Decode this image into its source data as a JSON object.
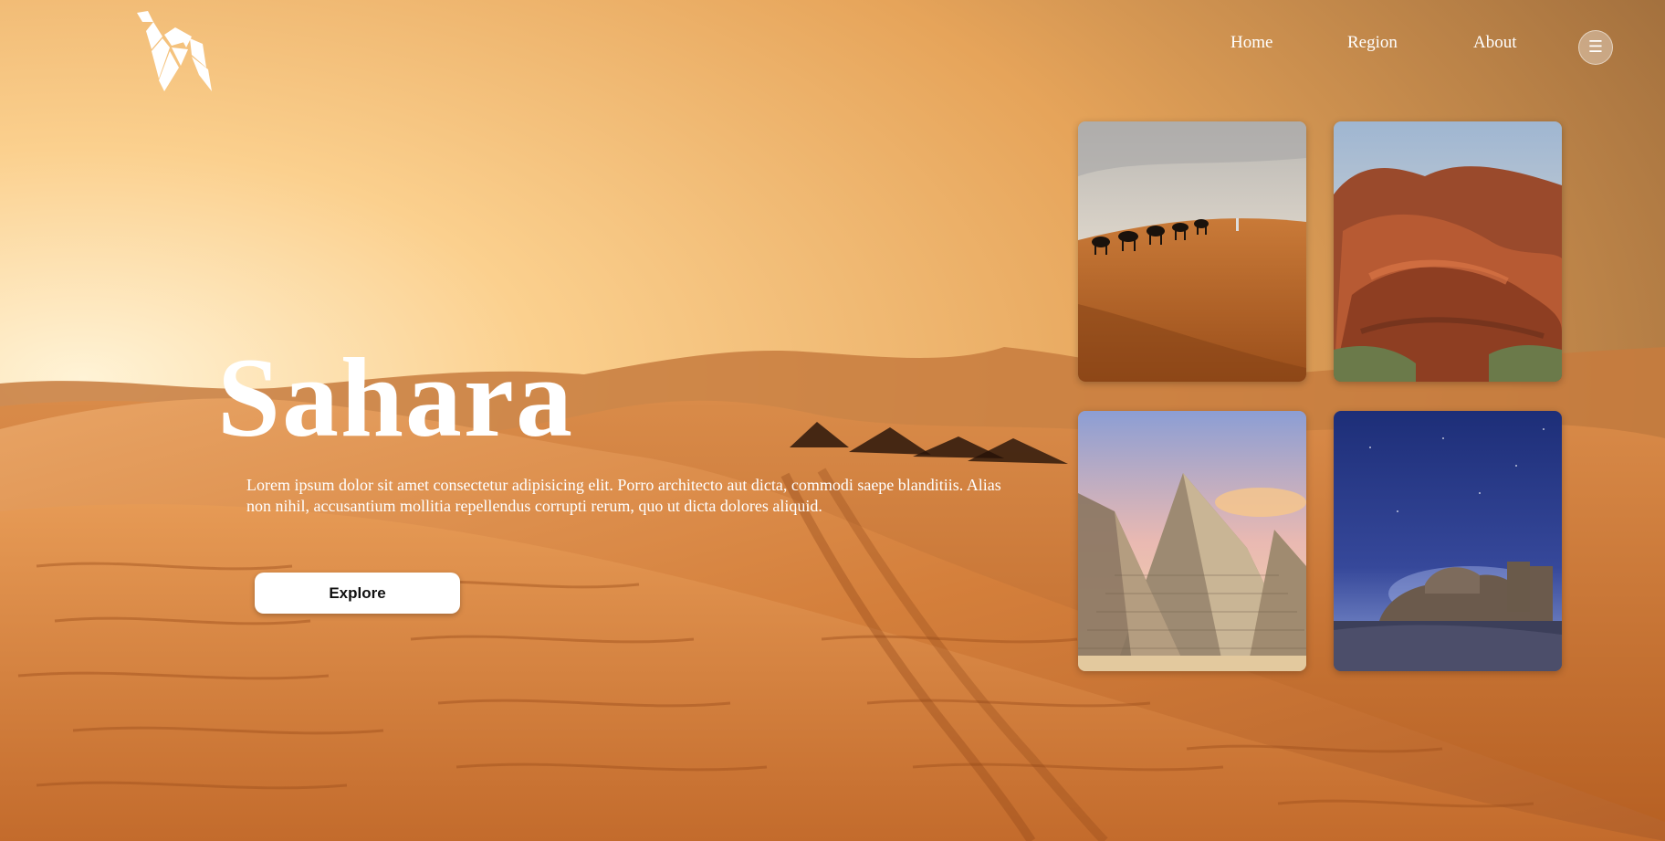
{
  "nav": {
    "home": "Home",
    "region": "Region",
    "about": "About",
    "menu_icon": "hamburger-icon"
  },
  "hero": {
    "title": "Sahara",
    "description": "Lorem ipsum dolor sit amet consectetur adipisicing elit. Porro architecto aut dicta, commodi saepe blanditiis. Alias non nihil, accusantium mollitia repellendus corrupti rerum, quo ut dicta dolores aliquid.",
    "cta": "Explore"
  },
  "gallery": [
    {
      "subject": "camel caravan on dunes"
    },
    {
      "subject": "red sandstone rocks"
    },
    {
      "subject": "pyramids of giza"
    },
    {
      "subject": "desert ruins under night sky"
    }
  ],
  "colors": {
    "sand_light": "#f6c98a",
    "sand_mid": "#d98a48",
    "sand_dark": "#a85a24",
    "text": "#ffffff",
    "button_bg": "#ffffff"
  }
}
